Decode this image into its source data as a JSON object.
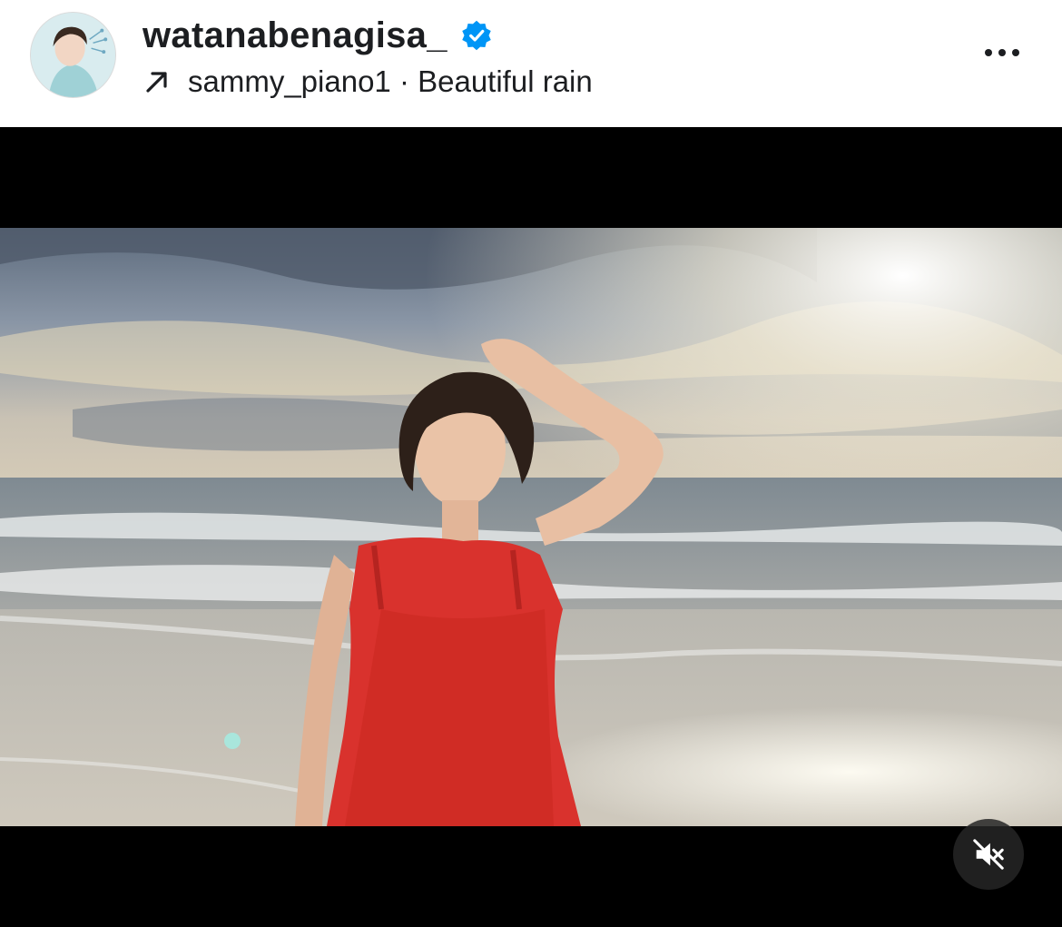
{
  "post_header": {
    "username": "watanabenagisa_",
    "verified": true,
    "audio_text": "sammy_piano1 · Beautiful rain"
  },
  "icons": {
    "verified": "verified-badge-icon",
    "audio_link": "arrow-up-right-icon",
    "more": "more-options-icon",
    "mute": "speaker-muted-icon"
  },
  "colors": {
    "verified_blue": "#0095f6",
    "text": "#1c1e21",
    "dress_red": "#d9322d"
  },
  "video": {
    "muted": true
  }
}
